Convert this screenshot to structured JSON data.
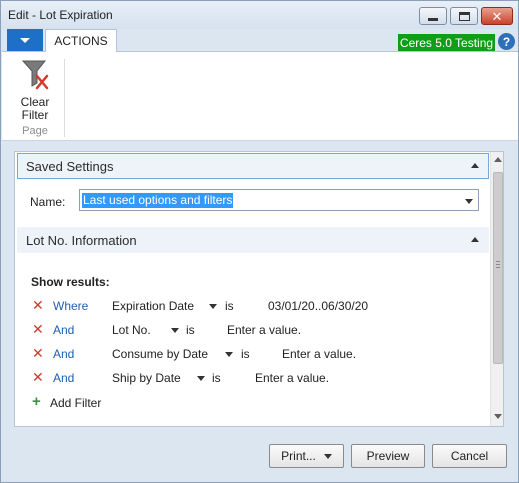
{
  "window": {
    "title": "Edit - Lot Expiration"
  },
  "ribbon": {
    "tab_actions": "ACTIONS",
    "environment": "Ceres 5.0 Testing",
    "help": "?",
    "clear_filter_line1": "Clear",
    "clear_filter_line2": "Filter",
    "group_label": "Page"
  },
  "saved_settings": {
    "header": "Saved Settings",
    "name_label": "Name:",
    "name_value": "Last used options and filters"
  },
  "lot_info": {
    "header": "Lot No. Information",
    "show_results": "Show results:",
    "filters": [
      {
        "conj": "Where",
        "field": "Expiration Date",
        "is": "is",
        "value": "03/01/20..06/30/20"
      },
      {
        "conj": "And",
        "field": "Lot No.",
        "is": "is",
        "value": "Enter a value."
      },
      {
        "conj": "And",
        "field": "Consume by Date",
        "is": "is",
        "value": "Enter a value."
      },
      {
        "conj": "And",
        "field": "Ship by Date",
        "is": "is",
        "value": "Enter a value."
      }
    ],
    "add_filter": "Add Filter"
  },
  "buttons": {
    "print": "Print...",
    "preview": "Preview",
    "cancel": "Cancel"
  },
  "colors": {
    "accent": "#1e6fc8",
    "environment_badge": "#119d1a",
    "remove_icon": "#d23a2a",
    "link": "#1e5fb0"
  }
}
